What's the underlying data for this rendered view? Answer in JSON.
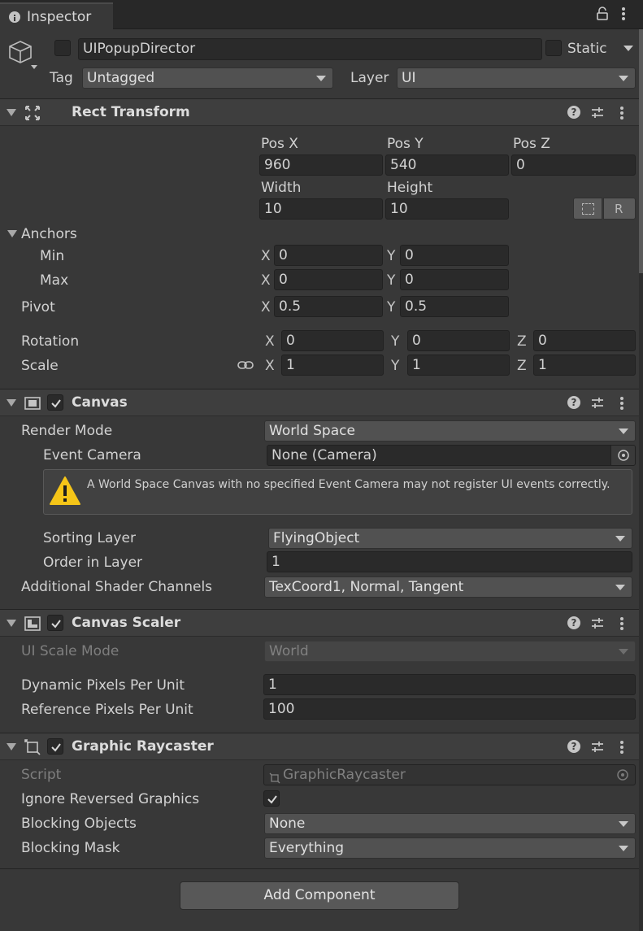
{
  "tab": {
    "title": "Inspector"
  },
  "gameobject": {
    "name": "UIPopupDirector",
    "static_label": "Static",
    "tag_label": "Tag",
    "tag_value": "Untagged",
    "layer_label": "Layer",
    "layer_value": "UI"
  },
  "rect_transform": {
    "title": "Rect Transform",
    "pos_x_label": "Pos X",
    "pos_x": "960",
    "pos_y_label": "Pos Y",
    "pos_y": "540",
    "pos_z_label": "Pos Z",
    "pos_z": "0",
    "width_label": "Width",
    "width": "10",
    "height_label": "Height",
    "height": "10",
    "anchors_label": "Anchors",
    "min_label": "Min",
    "min_x": "0",
    "min_y": "0",
    "max_label": "Max",
    "max_x": "0",
    "max_y": "0",
    "pivot_label": "Pivot",
    "pivot_x": "0.5",
    "pivot_y": "0.5",
    "rotation_label": "Rotation",
    "rot_x": "0",
    "rot_y": "0",
    "rot_z": "0",
    "scale_label": "Scale",
    "scale_x": "1",
    "scale_y": "1",
    "scale_z": "1",
    "x": "X",
    "y": "Y",
    "z": "Z"
  },
  "canvas": {
    "title": "Canvas",
    "render_mode_label": "Render Mode",
    "render_mode": "World Space",
    "event_camera_label": "Event Camera",
    "event_camera": "None (Camera)",
    "warning": "A World Space Canvas with no specified Event Camera may not register UI events correctly.",
    "sorting_layer_label": "Sorting Layer",
    "sorting_layer": "FlyingObject",
    "order_label": "Order in Layer",
    "order": "1",
    "shader_channels_label": "Additional Shader Channels",
    "shader_channels": "TexCoord1, Normal, Tangent"
  },
  "canvas_scaler": {
    "title": "Canvas Scaler",
    "scale_mode_label": "UI Scale Mode",
    "scale_mode": "World",
    "dynamic_label": "Dynamic Pixels Per Unit",
    "dynamic": "1",
    "reference_label": "Reference Pixels Per Unit",
    "reference": "100"
  },
  "graphic_raycaster": {
    "title": "Graphic Raycaster",
    "script_label": "Script",
    "script": "GraphicRaycaster",
    "ignore_label": "Ignore Reversed Graphics",
    "blocking_objects_label": "Blocking Objects",
    "blocking_objects": "None",
    "blocking_mask_label": "Blocking Mask",
    "blocking_mask": "Everything"
  },
  "add_component": "Add Component",
  "colors": {
    "background": "#383838",
    "header": "#3e3e3e",
    "field": "#2a2a2a",
    "dropdown": "#515151",
    "warning": "#f5c518"
  }
}
